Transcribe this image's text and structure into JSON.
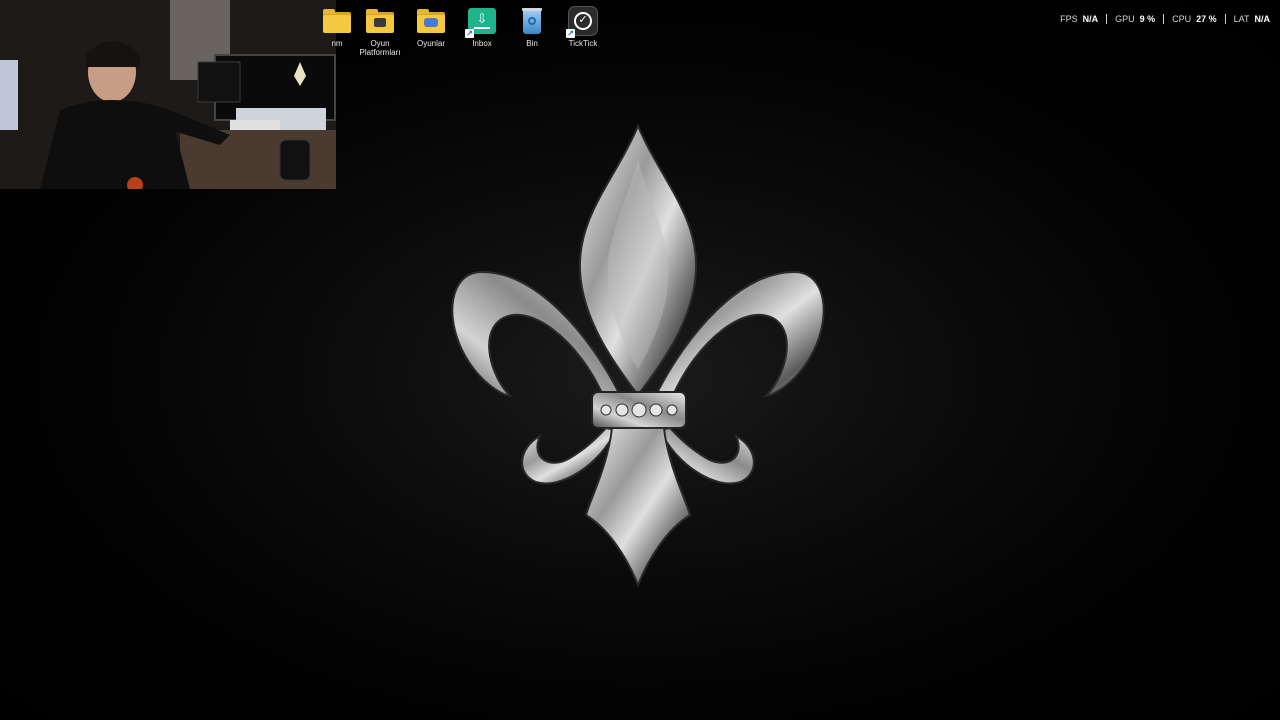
{
  "desktop": {
    "icons": [
      {
        "id": "cut",
        "label": "nm",
        "kind": "folder"
      },
      {
        "id": "oyun-platformlari",
        "label": "Oyun Platformları",
        "kind": "folder"
      },
      {
        "id": "oyunlar",
        "label": "Oyunlar",
        "kind": "folder"
      },
      {
        "id": "inbox",
        "label": "Inbox",
        "kind": "app"
      },
      {
        "id": "bin",
        "label": "Bin",
        "kind": "recycle-bin"
      },
      {
        "id": "ticktick",
        "label": "TickTick",
        "kind": "app"
      }
    ],
    "accent_colors": {
      "folder": "#f5c842",
      "inbox": "#1fb48a",
      "bin": "#3aa0e0",
      "ticktick": "#2e2e2e"
    }
  },
  "perf_overlay": {
    "fps": {
      "label": "FPS",
      "value": "N/A"
    },
    "gpu": {
      "label": "GPU",
      "value": "9 %"
    },
    "cpu": {
      "label": "CPU",
      "value": "27 %"
    },
    "lat": {
      "label": "LAT",
      "value": "N/A"
    }
  },
  "wallpaper": {
    "emblem": "fleur-de-lis",
    "background": "#000000",
    "metal_color": "#c8c8c8"
  }
}
